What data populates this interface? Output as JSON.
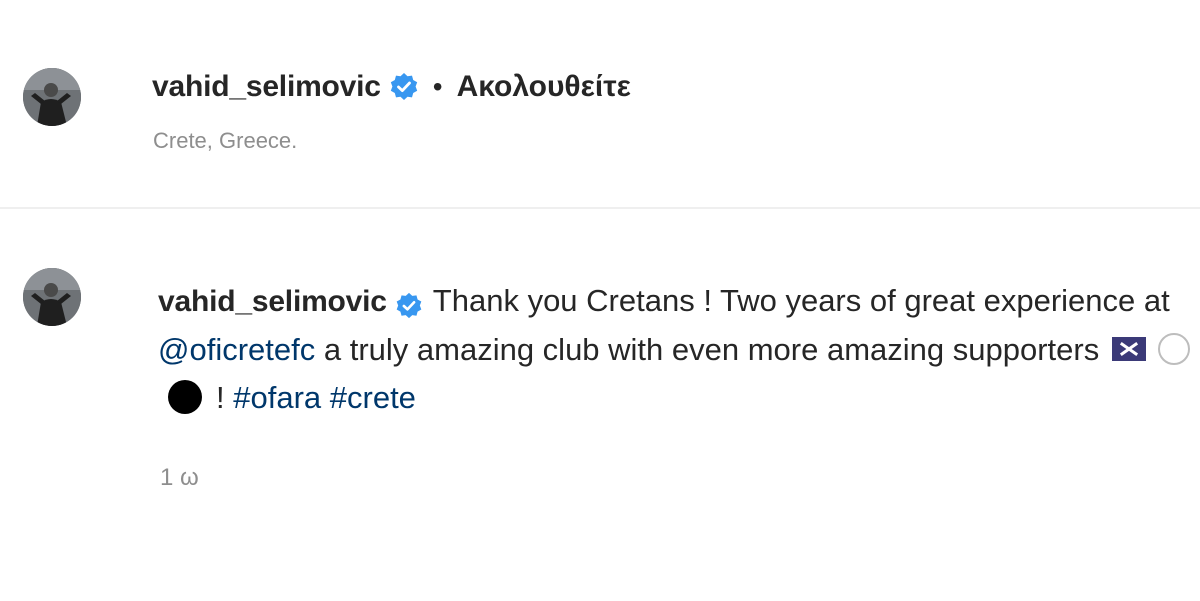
{
  "post_header": {
    "username": "vahid_selimovic",
    "separator": "•",
    "follow_status": "Ακολουθείτε",
    "location": "Crete, Greece."
  },
  "comment": {
    "username": "vahid_selimovic",
    "text_part1": "Thank you Cretans ! Two years of great experience at ",
    "mention": "@oficretefc",
    "text_part2": " a truly amazing club with even more amazing supporters ",
    "exclamation": "! ",
    "hashtag1": "#ofara",
    "space": " ",
    "hashtag2": "#crete",
    "timestamp": "1 ω"
  },
  "icons": {
    "verified": "verified-badge-icon",
    "flag": "flag-emoji-icon",
    "white_circle": "white-circle-emoji-icon",
    "black_circle": "black-circle-emoji-icon"
  },
  "colors": {
    "verified_blue": "#3897f0",
    "link_blue": "#00376b",
    "secondary_text": "#8e8e8e",
    "primary_text": "#262626"
  }
}
